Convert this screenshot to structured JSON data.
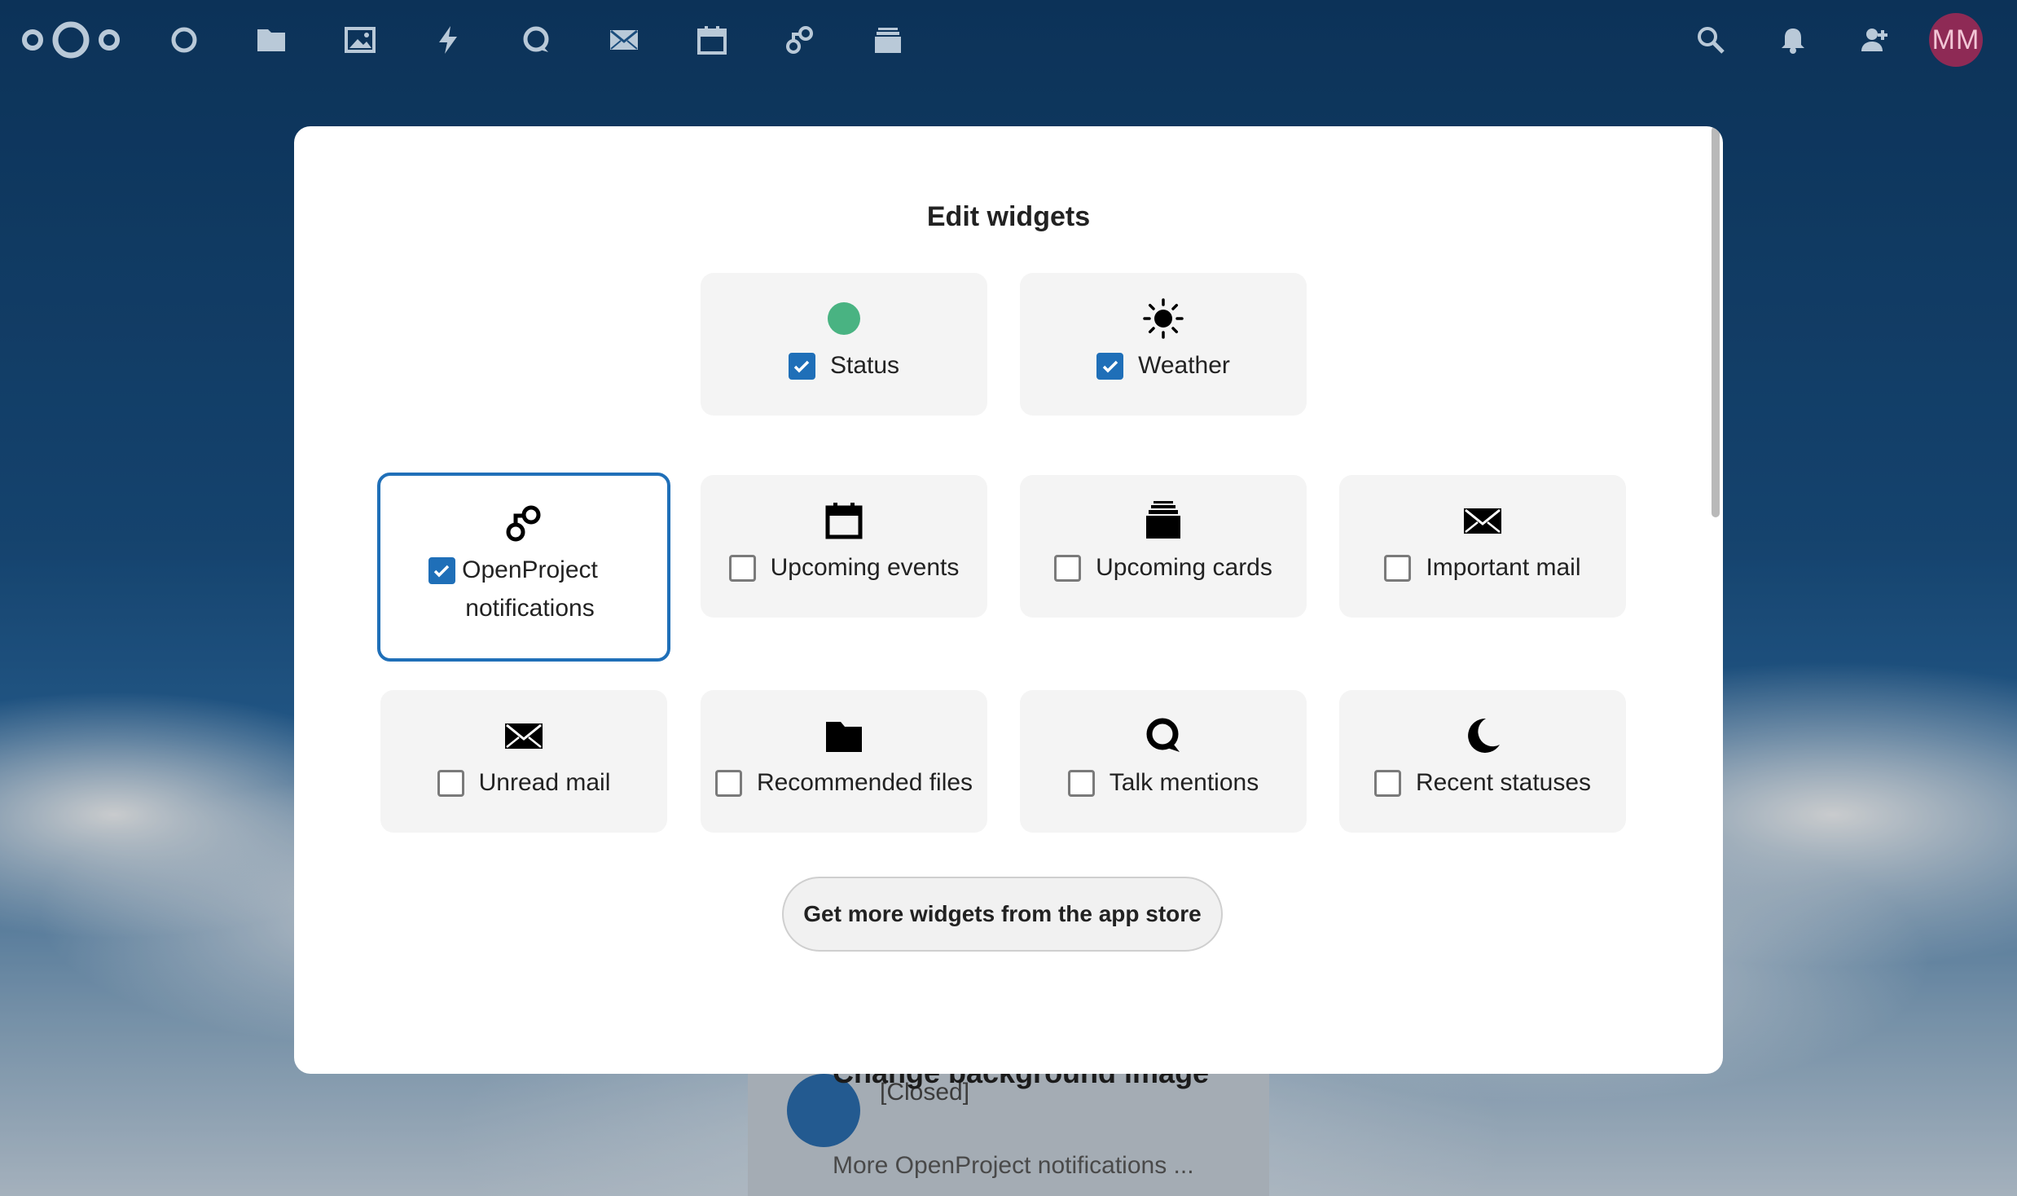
{
  "header": {
    "nav_icons": [
      "nextcloud-logo-icon",
      "dashboard-icon",
      "files-icon",
      "photos-icon",
      "activity-icon",
      "talk-icon",
      "mail-icon",
      "calendar-icon",
      "openproject-icon",
      "deck-icon"
    ],
    "right_icons": [
      "search-icon",
      "notifications-icon",
      "contacts-icon"
    ],
    "avatar_initials": "MM"
  },
  "background": {
    "closed_label": "[Closed]",
    "partial_title": "Change background image",
    "more_link": "More OpenProject notifications ..."
  },
  "modal": {
    "title": "Edit widgets",
    "store_button": "Get more widgets from the app store",
    "widgets": [
      {
        "label": "Status",
        "icon": "status-dot-icon",
        "checked": true
      },
      {
        "label": "Weather",
        "icon": "sun-icon",
        "checked": true
      },
      {
        "label": "OpenProject notifications",
        "icon": "openproject-icon",
        "checked": true,
        "selected": true
      },
      {
        "label": "Upcoming events",
        "icon": "calendar-icon",
        "checked": false
      },
      {
        "label": "Upcoming cards",
        "icon": "deck-icon",
        "checked": false
      },
      {
        "label": "Important mail",
        "icon": "mail-icon",
        "checked": false
      },
      {
        "label": "Unread mail",
        "icon": "mail-icon",
        "checked": false
      },
      {
        "label": "Recommended files",
        "icon": "folder-icon",
        "checked": false
      },
      {
        "label": "Talk mentions",
        "icon": "talk-icon",
        "checked": false
      },
      {
        "label": "Recent statuses",
        "icon": "moon-icon",
        "checked": false
      }
    ]
  },
  "colors": {
    "accent": "#1f6fb8",
    "status_green": "#49b382",
    "avatar_bg": "#8e2a55"
  }
}
